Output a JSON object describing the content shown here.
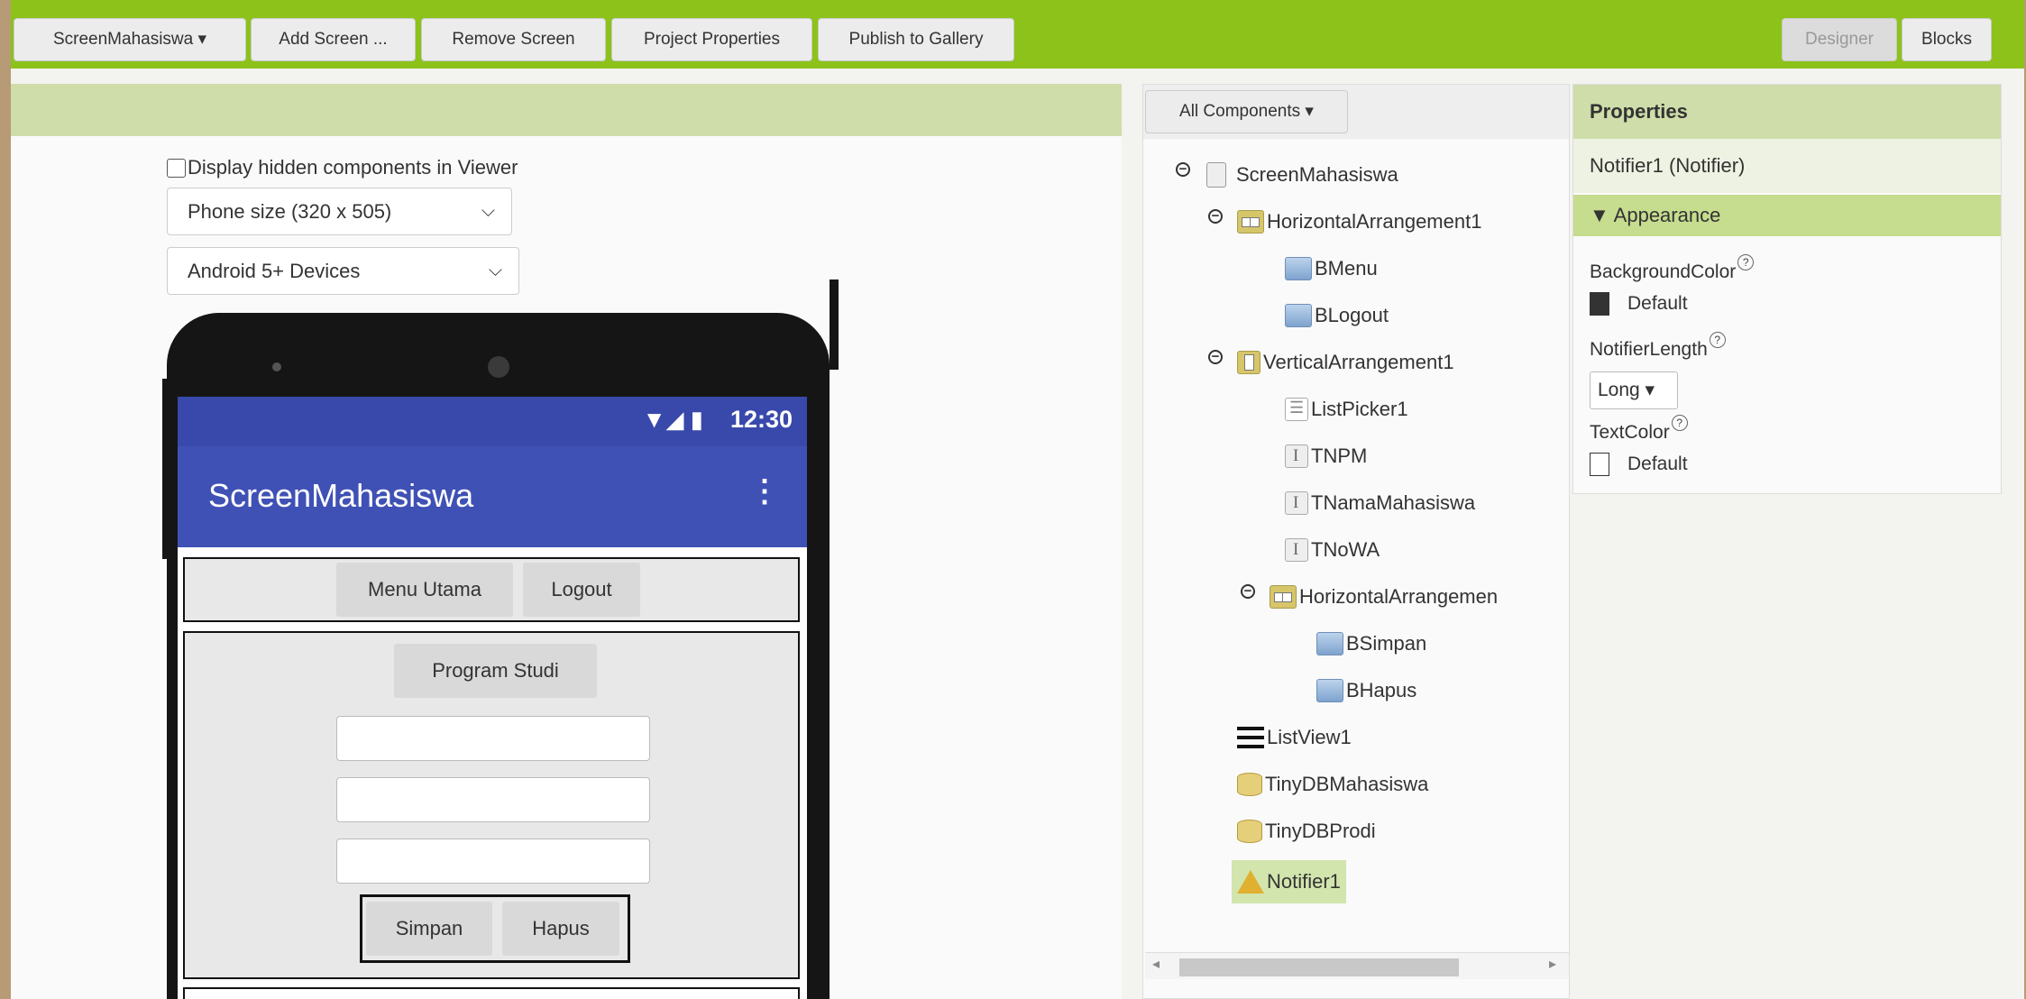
{
  "toolbar": {
    "screen_selector": "ScreenMahasiswa ▾",
    "add_screen": "Add Screen ...",
    "remove_screen": "Remove Screen",
    "project_properties": "Project Properties",
    "publish_gallery": "Publish to Gallery",
    "designer": "Designer",
    "blocks": "Blocks"
  },
  "viewer": {
    "hidden_components_label": "Display hidden components in Viewer",
    "phone_size": "Phone size (320 x 505)",
    "device_type": "Android 5+ Devices"
  },
  "phone": {
    "status_icons": "▼◢ ▮",
    "time": "12:30",
    "app_title": "ScreenMahasiswa",
    "menu_dots": "⋮",
    "buttons": {
      "menu_utama": "Menu Utama",
      "logout": "Logout",
      "program_studi": "Program Studi",
      "simpan": "Simpan",
      "hapus": "Hapus"
    }
  },
  "components": {
    "dropdown": "All Components ▾",
    "tree": [
      {
        "label": "ScreenMahasiswa",
        "icon": "screen-icon",
        "toggle": "−"
      },
      {
        "label": "HorizontalArrangement1",
        "icon": "horizontal-arrangement-icon",
        "toggle": "−"
      },
      {
        "label": "BMenu",
        "icon": "button-icon"
      },
      {
        "label": "BLogout",
        "icon": "button-icon"
      },
      {
        "label": "VerticalArrangement1",
        "icon": "vertical-arrangement-icon",
        "toggle": "−"
      },
      {
        "label": "ListPicker1",
        "icon": "listpicker-icon"
      },
      {
        "label": "TNPM",
        "icon": "textbox-icon"
      },
      {
        "label": "TNamaMahasiswa",
        "icon": "textbox-icon"
      },
      {
        "label": "TNoWA",
        "icon": "textbox-icon"
      },
      {
        "label": "HorizontalArrangemen",
        "icon": "horizontal-arrangement-icon",
        "toggle": "−"
      },
      {
        "label": "BSimpan",
        "icon": "button-icon"
      },
      {
        "label": "BHapus",
        "icon": "button-icon"
      },
      {
        "label": "ListView1",
        "icon": "listview-icon"
      },
      {
        "label": "TinyDBMahasiswa",
        "icon": "database-icon"
      },
      {
        "label": "TinyDBProdi",
        "icon": "database-icon"
      },
      {
        "label": "Notifier1",
        "icon": "warning-icon",
        "selected": true
      }
    ],
    "scroll_left": "◂",
    "scroll_right": "▸"
  },
  "properties": {
    "title": "Properties",
    "component": "Notifier1 (Notifier)",
    "section": "▼ Appearance",
    "help_icon": "?",
    "background_color_label": "BackgroundColor",
    "background_color_value": "Default",
    "background_color_swatch": "#333333",
    "notifier_length_label": "NotifierLength",
    "notifier_length_value": "Long ▾",
    "text_color_label": "TextColor",
    "text_color_value": "Default",
    "text_color_swatch": "#ffffff"
  },
  "colors": {
    "toolbar": "#8cc21a",
    "appbar": "#3f51b5",
    "statusbar": "#3949ab",
    "panel_header": "#cfddaa",
    "selection": "#d2e5ad"
  }
}
